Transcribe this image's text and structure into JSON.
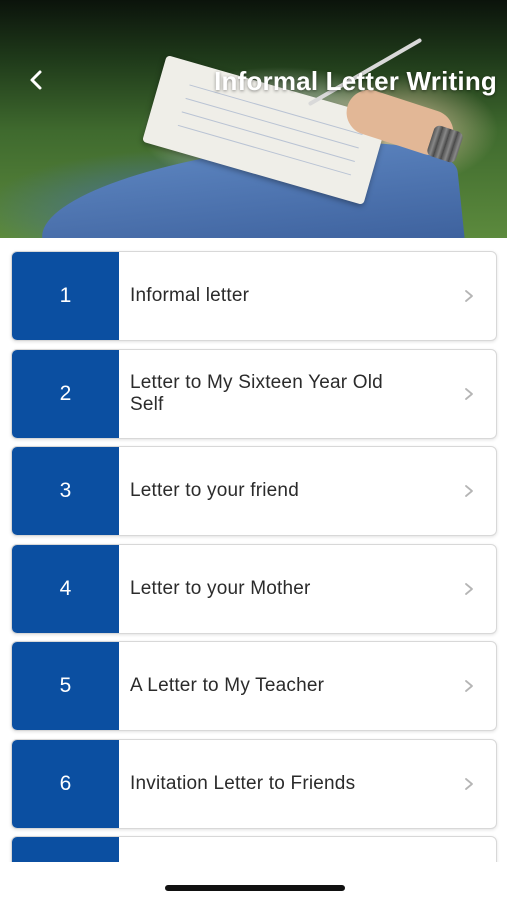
{
  "header": {
    "title": "Informal Letter Writing",
    "back_icon": "chevron-left-icon"
  },
  "list": {
    "items": [
      {
        "number": "1",
        "label": "Informal letter"
      },
      {
        "number": "2",
        "label": "Letter to My Sixteen Year Old Self"
      },
      {
        "number": "3",
        "label": "Letter to your friend"
      },
      {
        "number": "4",
        "label": "Letter to your Mother"
      },
      {
        "number": "5",
        "label": "A Letter to My Teacher"
      },
      {
        "number": "6",
        "label": "Invitation Letter to Friends"
      },
      {
        "number": "",
        "label": ""
      }
    ],
    "chevron_icon": "chevron-right-icon"
  },
  "colors": {
    "accent": "#0b4fa1",
    "text": "#2b2b2b",
    "chevron": "#b5b5b5"
  }
}
